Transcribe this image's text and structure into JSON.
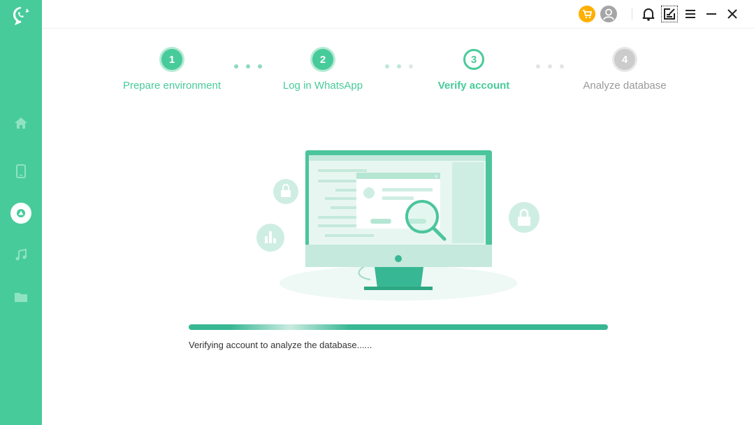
{
  "sidebar": {
    "items": [
      {
        "name": "home"
      },
      {
        "name": "device"
      },
      {
        "name": "google-drive",
        "active": true
      },
      {
        "name": "music"
      },
      {
        "name": "folder"
      }
    ]
  },
  "toolbar": {
    "icons": [
      "cart-icon",
      "account-icon",
      "bell-icon",
      "feedback-icon",
      "menu-icon",
      "minimize-icon",
      "close-icon"
    ]
  },
  "steps": [
    {
      "number": "1",
      "label": "Prepare environment",
      "state": "done"
    },
    {
      "number": "2",
      "label": "Log in WhatsApp",
      "state": "done"
    },
    {
      "number": "3",
      "label": "Verify account",
      "state": "active"
    },
    {
      "number": "4",
      "label": "Analyze database",
      "state": "pending"
    }
  ],
  "status_text": "Verifying account to analyze the database......",
  "colors": {
    "brand": "#48cb9a",
    "progress": "#38b794",
    "pending": "#cccccc",
    "cart": "#ffb000"
  }
}
